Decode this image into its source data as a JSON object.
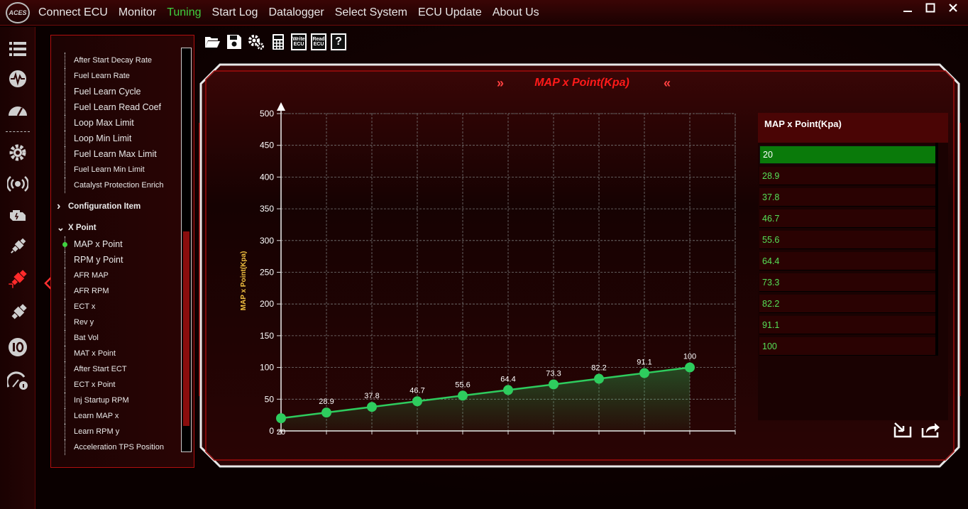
{
  "app": {
    "logo_text": "ACES",
    "menu": [
      "Connect ECU",
      "Monitor",
      "Tuning",
      "Start Log",
      "Datalogger",
      "Select System",
      "ECU Update",
      "About Us"
    ],
    "active_menu": "Tuning",
    "window_controls": [
      "minimize-icon",
      "maximize-icon",
      "close-icon"
    ]
  },
  "sidebar": {
    "icons": [
      "list-icon",
      "pulse-icon",
      "gauge-icon",
      "gear-icon",
      "broadcast-icon",
      "engine-icon",
      "spark-plug-icon",
      "injector-icon",
      "injector-alt-icon",
      "io-icon",
      "speedometer-info-icon"
    ],
    "active_icon": "injector-icon"
  },
  "tree": {
    "items": [
      {
        "label": "After Start Decay Rate",
        "type": "leaf"
      },
      {
        "label": "Fuel Learn Rate",
        "type": "leaf"
      },
      {
        "label": "Fuel Learn Cycle",
        "type": "leaf-big"
      },
      {
        "label": "Fuel Learn Read Coef",
        "type": "leaf-big"
      },
      {
        "label": "Loop Max Limit",
        "type": "leaf-big"
      },
      {
        "label": "Loop Min Limit",
        "type": "leaf-big"
      },
      {
        "label": "Fuel Learn Max Limit",
        "type": "leaf-big"
      },
      {
        "label": "Fuel Learn Min Limit",
        "type": "leaf"
      },
      {
        "label": "Catalyst Protection Enrich",
        "type": "leaf"
      },
      {
        "label": "Configuration Item",
        "type": "group",
        "arrow": ">"
      },
      {
        "label": "X Point",
        "type": "group",
        "arrow": "v"
      },
      {
        "label": "MAP x Point",
        "type": "leaf-big",
        "selected": true
      },
      {
        "label": "RPM y Point",
        "type": "leaf-big"
      },
      {
        "label": "AFR MAP",
        "type": "leaf"
      },
      {
        "label": "AFR RPM",
        "type": "leaf"
      },
      {
        "label": "ECT x",
        "type": "leaf"
      },
      {
        "label": "Rev y",
        "type": "leaf"
      },
      {
        "label": "Bat Vol",
        "type": "leaf"
      },
      {
        "label": "MAT x Point",
        "type": "leaf"
      },
      {
        "label": "After Start ECT",
        "type": "leaf"
      },
      {
        "label": "ECT x Point",
        "type": "leaf"
      },
      {
        "label": "Inj Startup RPM",
        "type": "leaf"
      },
      {
        "label": "Learn MAP x",
        "type": "leaf"
      },
      {
        "label": "Learn RPM y",
        "type": "leaf"
      },
      {
        "label": "Acceleration TPS Position",
        "type": "leaf"
      }
    ]
  },
  "toolbar": {
    "icons": [
      "folder-open-icon",
      "save-icon",
      "settings-icon",
      "calculator-icon",
      "write-ecu-icon",
      "read-ecu-icon",
      "help-icon"
    ],
    "write_label_1": "Write",
    "write_label_2": "ECU",
    "read_label_1": "Read",
    "read_label_2": "ECU",
    "help_label": "?"
  },
  "main": {
    "title": "MAP x Point(Kpa)",
    "title_left_chev": "»",
    "title_right_chev": "«"
  },
  "chart_data": {
    "type": "line",
    "title": "",
    "ylabel": "MAP x Point(Kpa)",
    "xlabel": "",
    "ylim": [
      0,
      500
    ],
    "yticks": [
      0,
      50,
      100,
      150,
      200,
      250,
      300,
      350,
      400,
      450,
      500
    ],
    "x": [
      1,
      2,
      3,
      4,
      5,
      6,
      7,
      8,
      9,
      10
    ],
    "series": [
      {
        "values": [
          20,
          28.9,
          37.8,
          46.7,
          55.6,
          64.4,
          73.3,
          82.2,
          91.1,
          100
        ]
      }
    ],
    "grid": true,
    "line_color": "#2ecc5e",
    "fill": "area"
  },
  "value_table": {
    "header": "MAP x Point(Kpa)",
    "values": [
      "20",
      "28.9",
      "37.8",
      "46.7",
      "55.6",
      "64.4",
      "73.3",
      "82.2",
      "91.1",
      "100"
    ],
    "selected_index": 0
  },
  "actions": [
    "import-icon",
    "export-icon"
  ],
  "colors": {
    "accent_red": "#ff1a1a",
    "active_green": "#3fd13f",
    "selected_row": "#0a7a0a"
  }
}
